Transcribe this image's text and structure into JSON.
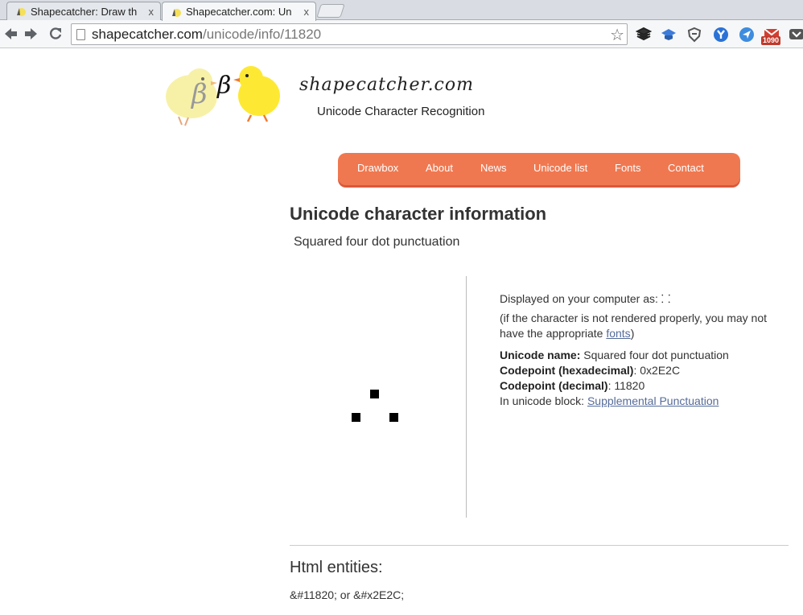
{
  "browser": {
    "tabs": [
      {
        "title": "Shapecatcher: Draw th",
        "close": "x",
        "active": false
      },
      {
        "title": "Shapecatcher.com: Un",
        "close": "x",
        "active": true
      }
    ],
    "url_host": "shapecatcher.com",
    "url_path": "/unicode/info/11820",
    "mail_badge": "1090",
    "icons": {
      "back": "back-arrow-icon",
      "forward": "forward-arrow-icon",
      "reload": "reload-icon",
      "bookmark": "star-icon"
    }
  },
  "site": {
    "title": "shapecatcher.com",
    "subtitle": "Unicode Character Recognition",
    "logo_glyph_1": "β",
    "logo_glyph_2": "β",
    "nav": [
      "Drawbox",
      "About",
      "News",
      "Unicode list",
      "Fonts",
      "Contact"
    ],
    "nav_color": "#f07850"
  },
  "content": {
    "page_title": "Unicode character information",
    "char_name_heading": "Squared four dot punctuation",
    "displayed_label": "Displayed on your computer as:",
    "displayed_glyph": "⸬",
    "render_note_1": "(if the character is not rendered properly, you may not have the appropriate ",
    "render_note_link": "fonts",
    "render_note_2": ")",
    "name_label": "Unicode name:",
    "name_value": "Squared four dot punctuation",
    "cp_hex_label": "Codepoint (hexadecimal)",
    "cp_hex_value": ": 0x2E2C",
    "cp_dec_label": "Codepoint (decimal)",
    "cp_dec_value": ": 11820",
    "block_label": "In unicode block: ",
    "block_link": "Supplemental Punctuation",
    "entities_heading": "Html entities:",
    "entities_text": "&#11820; or &#x2E2C;"
  }
}
